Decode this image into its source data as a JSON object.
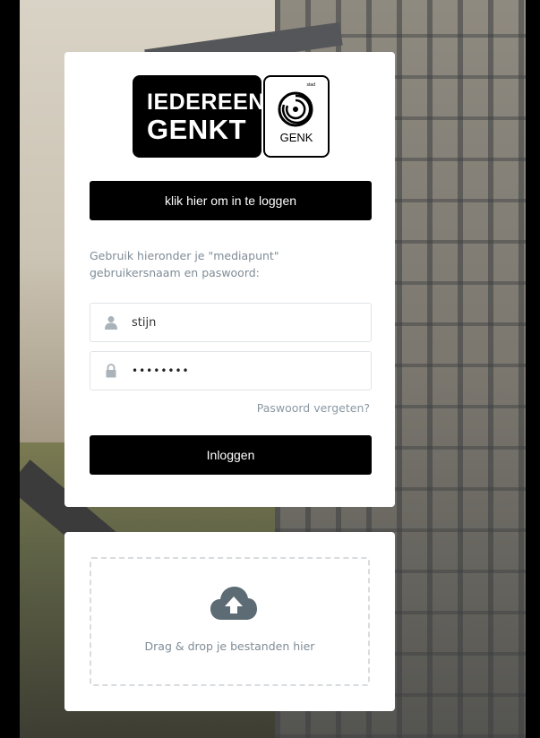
{
  "logo": {
    "line1": "IEDEREEN",
    "line2": "GENKT",
    "seal_text": "GENK",
    "seal_small": "stad"
  },
  "login": {
    "sso_button_label": "klik hier om in te loggen",
    "instruction": "Gebruik hieronder je \"mediapunt\" gebruikersnaam en paswoord:",
    "username_value": "stijn",
    "password_value": "••••••••",
    "forgot_label": "Paswoord vergeten?",
    "submit_label": "Inloggen"
  },
  "upload": {
    "drop_label": "Drag & drop je bestanden hier"
  },
  "icons": {
    "username": "user-icon",
    "password": "lock-icon",
    "upload": "cloud-upload-icon"
  },
  "colors": {
    "button_bg": "#000000",
    "muted_text": "#7f8c96",
    "icon_gray": "#aab3b9",
    "cloud_gray": "#5d6b74"
  }
}
